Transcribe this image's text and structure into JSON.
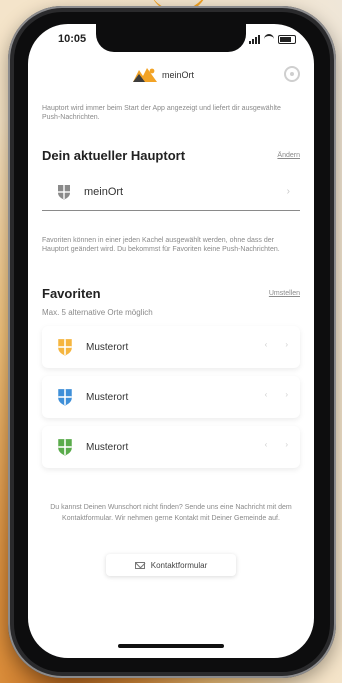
{
  "status": {
    "time": "10:05"
  },
  "app": {
    "logo_text": "meinOrt"
  },
  "intro_text": "Hauptort wird immer beim Start der App angezeigt und liefert dir ausgewählte Push-Nachrichten.",
  "main": {
    "title": "Dein aktueller Hauptort",
    "edit_link": "Ändern",
    "place": "meinOrt",
    "chevron": "›"
  },
  "favorites_text": "Favoriten können in einer jeden Kachel ausgewählt werden, ohne dass der Hauptort geändert wird. Du bekommst für Favoriten keine Push-Nachrichten.",
  "favorites": {
    "title": "Favoriten",
    "sort_link": "Umstellen",
    "subtitle": "Max. 5 alternative Orte möglich",
    "items": [
      {
        "label": "Musterort",
        "color": "#f5b53f"
      },
      {
        "label": "Musterort",
        "color": "#3f8fd8"
      },
      {
        "label": "Musterort",
        "color": "#5aab4b"
      }
    ],
    "action_a": "‹",
    "action_b": "›"
  },
  "footer": {
    "text": "Du kannst Deinen Wunschort nicht finden? Sende uns eine Nachricht mit dem Kontaktformular. Wir nehmen gerne Kontakt mit Deiner Gemeinde auf.",
    "contact_label": "Kontaktformular"
  },
  "colors": {
    "accent": "#f2a326",
    "text": "#222222",
    "muted": "#8a8a8a"
  }
}
